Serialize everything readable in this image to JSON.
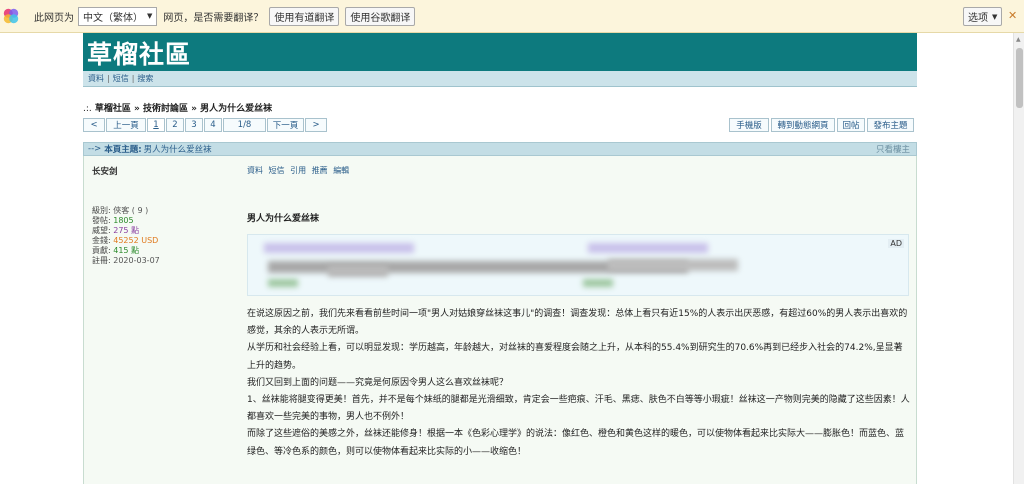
{
  "translate_bar": {
    "prompt": "此网页为",
    "language": "中文（繁体）",
    "question": "网页，是否需要翻译？",
    "btn_youdao": "使用有道翻译",
    "btn_google": "使用谷歌翻译",
    "options": "选项",
    "close": "✕"
  },
  "site": {
    "title": "草榴社區",
    "subnav": [
      "資料",
      "短信",
      "搜索"
    ]
  },
  "breadcrumb": {
    "prefix": ".:.",
    "items": [
      "草榴社區",
      "技術討論區"
    ],
    "current": "男人为什么爱丝袜"
  },
  "pager": {
    "prev": "<",
    "prev_page": "上一頁",
    "pages": [
      "1",
      "2",
      "3",
      "4"
    ],
    "current": "1",
    "indicator": "1/8",
    "next_page": "下一頁",
    "next": ">"
  },
  "actions": [
    "手機版",
    "轉到動態網頁",
    "回帖",
    "發布主題"
  ],
  "thread_header": {
    "arrow": "-->",
    "label": "本頁主題:",
    "title": "男人为什么爱丝袜",
    "only_author": "只看樓主"
  },
  "user": {
    "name": "长安剑",
    "rows": [
      {
        "label": "級別:",
        "value": "俠客 ( 9 )",
        "color": "#555555"
      },
      {
        "label": "發帖:",
        "value": "1805",
        "color": "#2b8a2b"
      },
      {
        "label": "威望:",
        "value": "275 點",
        "color": "#8a3fa0"
      },
      {
        "label": "金錢:",
        "value": "45252 USD",
        "color": "#e07a1f"
      },
      {
        "label": "貢獻:",
        "value": "415 點",
        "color": "#2b8a2b"
      },
      {
        "label": "註冊:",
        "value": "2020-03-07",
        "color": "#555555"
      }
    ]
  },
  "post": {
    "links": [
      "資料",
      "短信",
      "引用",
      "推薦",
      "編輯"
    ],
    "title": "男人为什么爱丝袜",
    "ad_tag": "AD",
    "paragraphs": [
      "在说这原因之前，我们先来看看前些时间一项\"男人对姑娘穿丝袜这事儿\"的调查！调查发现：总体上看只有近15%的人表示出厌恶感，有超过60%的男人表示出喜欢的感觉，其余的人表示无所谓。",
      "从学历和社会经验上看，可以明显发现：学历越高，年龄越大，对丝袜的喜爱程度会随之上升，从本科的55.4%到研究生的70.6%再到已经步入社会的74.2%,呈显著上升的趋势。",
      "我们又回到上面的问题——究竟是何原因令男人这么喜欢丝袜呢？",
      "1、丝袜能将腿变得更美！首先，并不是每个妹纸的腿都是光滑细致，肯定会一些疤痕、汗毛、黑痣、肤色不白等等小瑕疵！丝袜这一产物则完美的隐藏了这些因素！人都喜欢一些完美的事物，男人也不例外！",
      "而除了这些遮俗的美感之外，丝袜还能修身！根据一本《色彩心理学》的说法：像红色、橙色和黄色这样的暖色，可以使物体看起来比实际大——膨胀色！而蓝色、蓝绿色、等冷色系的颜色，则可以使物体看起来比实际的小——收缩色！"
    ]
  }
}
